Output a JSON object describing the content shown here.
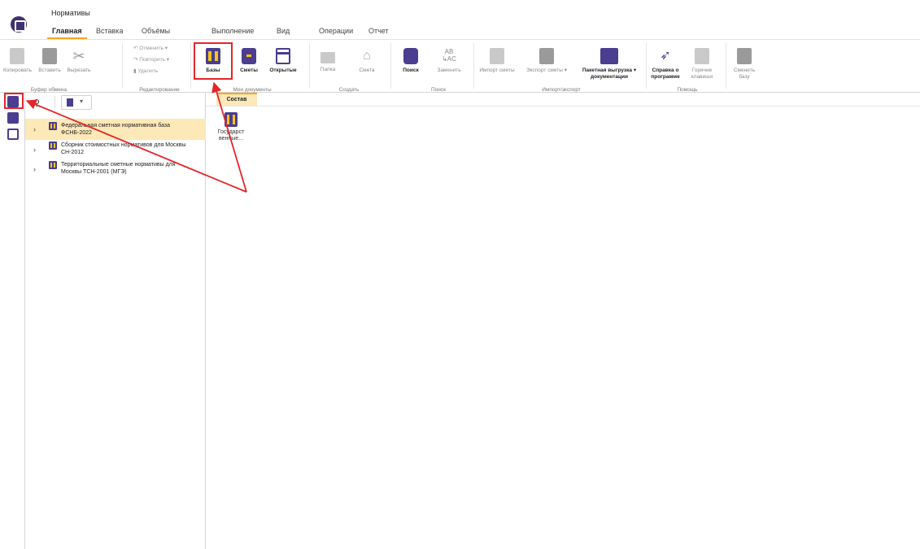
{
  "app": {
    "title": "Нормативы"
  },
  "tabs": [
    "Главная",
    "Вставка",
    "Объёмы",
    "Выполнение",
    "Вид",
    "Операции",
    "Отчет"
  ],
  "ribbon": {
    "clipboard": {
      "copy": "Копировать",
      "paste": "Вставить",
      "cut": "Вырезать",
      "group": "Буфер обмена"
    },
    "edit": {
      "undo": "Отменить",
      "redo": "Повторить",
      "delete": "Удалить",
      "group": "Редактирование"
    },
    "docs": {
      "bases": "Базы",
      "estimates": "Сметы",
      "opened": "Открытые",
      "group": "Мои документы"
    },
    "create": {
      "folder": "Папка",
      "estimate": "Смета",
      "group": "Создать"
    },
    "search": {
      "find": "Поиск",
      "replace": "Заменить",
      "group": "Поиск"
    },
    "io": {
      "import": "Импорт сметы",
      "export": "Экспорт сметы",
      "batch_line1": "Пакетная выгрузка",
      "batch_line2": "документации",
      "group": "Импорт/экспорт"
    },
    "help": {
      "about_line1": "Справка о",
      "about_line2": "программе",
      "hotkeys_line1": "Горячие",
      "hotkeys_line2": "клавиши",
      "group": "Помощь"
    },
    "base": {
      "change_line1": "Сменить",
      "change_line2": "базу"
    }
  },
  "tree": {
    "items": [
      {
        "line1": "Федеральная сметная нормативная база",
        "line2": "ФСНБ-2022",
        "selected": true
      },
      {
        "line1": "Сборник стоимостных нормативов для Москвы",
        "line2": "СН-2012",
        "selected": false
      },
      {
        "line1": "Территориальные сметные нормативы для",
        "line2": "Москвы ТСН-2001 (МГЭ)",
        "selected": false
      }
    ]
  },
  "content": {
    "tab": "Состав",
    "item_line1": "Государст",
    "item_line2": "венные..."
  },
  "colors": {
    "accent": "#f5a623",
    "brand": "#4b3d8f",
    "highlight": "#e3262b",
    "selected": "#fde8b8"
  }
}
